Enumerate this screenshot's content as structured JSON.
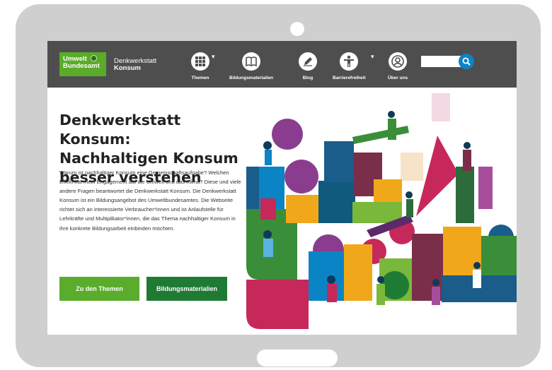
{
  "header": {
    "logo": {
      "line1": "Umwelt",
      "line2": "Bundesamt"
    },
    "site_name": {
      "line1": "Denkwerkstatt",
      "line2": "Konsum"
    },
    "nav": [
      {
        "label": "Themen",
        "icon": "grid-icon",
        "has_dropdown": true
      },
      {
        "label": "Bildungsmaterialien",
        "icon": "book-icon",
        "has_dropdown": false
      },
      {
        "label": "Blog",
        "icon": "pencil-icon",
        "has_dropdown": false
      },
      {
        "label": "Barrierefreiheit",
        "icon": "accessibility-icon",
        "has_dropdown": true
      },
      {
        "label": "Über uns",
        "icon": "user-icon",
        "has_dropdown": false
      }
    ],
    "search": {
      "placeholder": "",
      "icon": "search-icon"
    }
  },
  "hero": {
    "title": "Denkwerkstatt Konsum: Nachhaltigen Konsum besser verstehen",
    "intro": "Warum ist nachhaltiger Konsum eine Gemeinschaftsaufgabe? Welchen Effekt hat mein Engagement auf die Umwelt und das Klima? Diese und viele andere Fragen beantwortet die Denkwerkstatt Konsum. Die Denkwerkstatt Konsum ist ein Bildungsangebot des Umweltbundesamtes. Die Webseite richtet sich an interessierte Verbraucher*innen und ist Anlaufstelle für Lehrkräfte und Multiplikator*innen, die das Thema nachhaltiger Konsum in ihre konkrete Bildungsarbeit einbinden möchten.",
    "buttons": {
      "themes": "Zu den Themen",
      "materials": "Bildungsmaterialien"
    }
  },
  "colors": {
    "header_bg": "#4e4e4e",
    "logo_green": "#5bab2b",
    "btn_light_green": "#5aad2c",
    "btn_dark_green": "#1f7a34",
    "search_blue": "#0b84c6",
    "device_gray": "#cfcfcf"
  }
}
